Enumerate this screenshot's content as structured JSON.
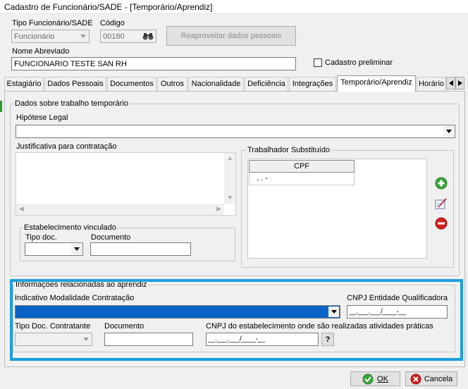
{
  "window": {
    "title": "Cadastro de Funcionário/SADE - [Temporário/Aprendiz]"
  },
  "header": {
    "tipo_label": "Tipo Funcionário/SADE",
    "tipo_value": "Funcionário",
    "codigo_label": "Código",
    "codigo_value": "00180",
    "reaproveitar_label": "Reaproveitar dados pessoais",
    "nome_label": "Nome Abreviado",
    "nome_value": "FUNCIONARIO TESTE SAN RH",
    "cadastro_label": "Cadastro preliminar"
  },
  "tabs": [
    {
      "label": "Estagiário"
    },
    {
      "label": "Dados Pessoais"
    },
    {
      "label": "Documentos"
    },
    {
      "label": "Outros"
    },
    {
      "label": "Nacionalidade"
    },
    {
      "label": "Deficiência"
    },
    {
      "label": "Integrações"
    },
    {
      "label": "Temporário/Aprendiz",
      "active": true
    },
    {
      "label": "Horário"
    }
  ],
  "temp": {
    "group_label": "Dados sobre trabalho temporário",
    "hipotese_label": "Hipótese Legal",
    "hipotese_value": "",
    "justificativa_label": "Justificativa para contratação",
    "estab_group": "Estabelecimento vinculado",
    "tipo_doc_label": "Tipo doc.",
    "documento_label": "Documento",
    "substituido_group": "Trabalhador Substituído",
    "cpf_header": "CPF",
    "cpf_row": ". . -"
  },
  "aprendiz": {
    "group_label": "Informações relacionadas ao aprendiz",
    "indicativo_label": "Indicativo Modalidade Contratação",
    "cnpj_ent_label": "CNPJ Entidade Qualificadora",
    "cnpj_ent_value": "__.___.___/____-__",
    "tipo_doc_label": "Tipo Doc. Contratante",
    "documento_label": "Documento",
    "cnpj_estab_label": "CNPJ do estabelecimento onde são realizadas atividades práticas",
    "cnpj_estab_value": "__.___.___/____-__",
    "help_label": "?"
  },
  "footer": {
    "ok_label": "OK",
    "cancel_label": "Cancela"
  },
  "icons": [
    "binoculars-icon",
    "add-icon",
    "edit-icon",
    "remove-icon",
    "check-icon",
    "cancel-icon",
    "chevron-down-icon"
  ],
  "colors": {
    "highlight": "#1aa0dc",
    "selection": "#0a64c8",
    "add": "#3aa63a",
    "remove": "#d42020"
  }
}
